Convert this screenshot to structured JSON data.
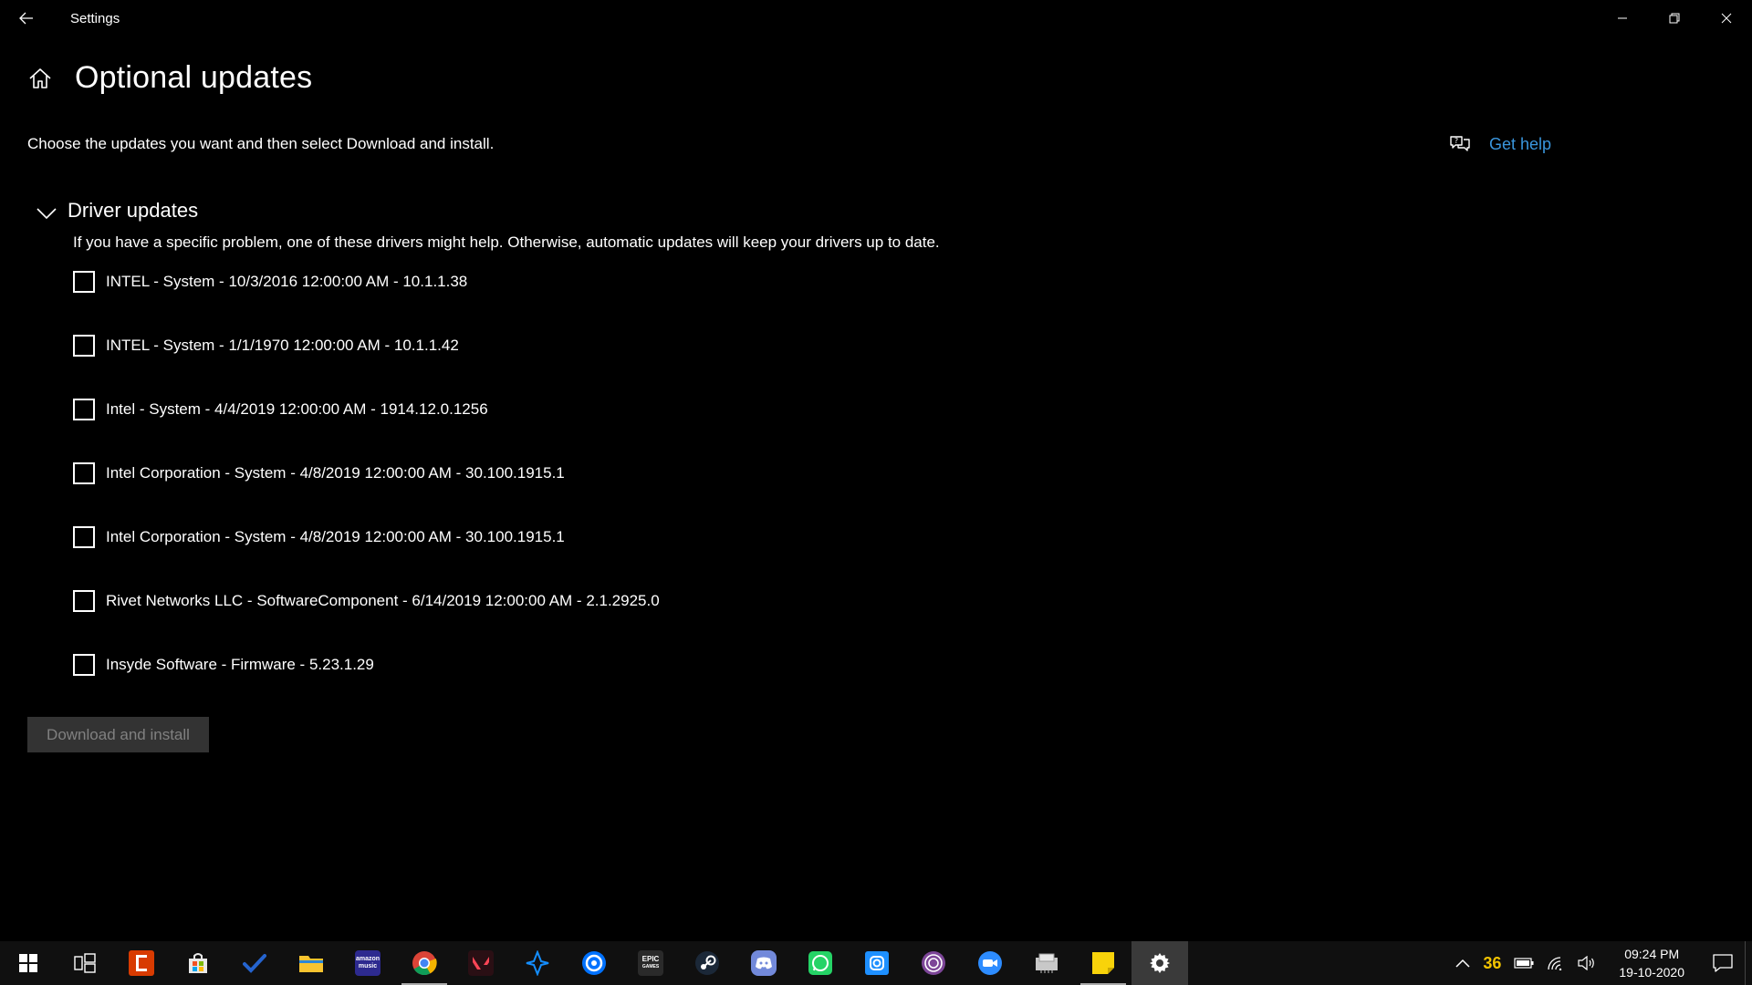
{
  "window": {
    "title": "Settings"
  },
  "page": {
    "title": "Optional updates",
    "description": "Choose the updates you want and then select Download and install.",
    "help_label": "Get help"
  },
  "section": {
    "title": "Driver updates",
    "description": "If you have a specific problem, one of these drivers might help. Otherwise, automatic updates will keep your drivers up to date.",
    "drivers": [
      {
        "label": "INTEL - System - 10/3/2016 12:00:00 AM - 10.1.1.38",
        "checked": false
      },
      {
        "label": "INTEL - System - 1/1/1970 12:00:00 AM - 10.1.1.42",
        "checked": false
      },
      {
        "label": "Intel - System - 4/4/2019 12:00:00 AM - 1914.12.0.1256",
        "checked": false
      },
      {
        "label": "Intel Corporation - System - 4/8/2019 12:00:00 AM - 30.100.1915.1",
        "checked": false
      },
      {
        "label": "Intel Corporation - System - 4/8/2019 12:00:00 AM - 30.100.1915.1",
        "checked": false
      },
      {
        "label": "Rivet Networks LLC - SoftwareComponent - 6/14/2019 12:00:00 AM - 2.1.2925.0",
        "checked": false
      },
      {
        "label": "Insyde Software - Firmware - 5.23.1.29",
        "checked": false
      }
    ]
  },
  "actions": {
    "download_label": "Download and install",
    "download_enabled": false
  },
  "taskbar": {
    "apps": [
      {
        "name": "task-view",
        "icon": "task-view-icon"
      },
      {
        "name": "office",
        "icon": "office-icon",
        "color": "#d83b01"
      },
      {
        "name": "store",
        "icon": "store-icon"
      },
      {
        "name": "todo",
        "icon": "todo-icon",
        "color": "#2564cf"
      },
      {
        "name": "file-explorer",
        "icon": "folder-icon",
        "color": "#f8c42f"
      },
      {
        "name": "amazon-music",
        "icon": "amazon-music-icon",
        "color": "#2d2a8f",
        "text": "amazon music"
      },
      {
        "name": "chrome",
        "icon": "chrome-icon",
        "running": true
      },
      {
        "name": "valorant",
        "icon": "valorant-icon",
        "color": "#fd4556"
      },
      {
        "name": "battle-net",
        "icon": "battlenet-icon",
        "color": "#148eff"
      },
      {
        "name": "uplay",
        "icon": "uplay-icon",
        "color": "#0072ff"
      },
      {
        "name": "epic-games",
        "icon": "epic-games-icon",
        "text": "EPIC GAMES"
      },
      {
        "name": "steam",
        "icon": "steam-icon",
        "color": "#1b2838"
      },
      {
        "name": "discord",
        "icon": "discord-icon",
        "color": "#7289da"
      },
      {
        "name": "whatsapp",
        "icon": "whatsapp-icon",
        "color": "#25d366"
      },
      {
        "name": "instagram",
        "icon": "instagram-icon",
        "color": "#1e90ff"
      },
      {
        "name": "tor-browser",
        "icon": "tor-icon",
        "color": "#7d4698"
      },
      {
        "name": "zoom",
        "icon": "zoom-icon",
        "color": "#2d8cff"
      },
      {
        "name": "cpu-tool",
        "icon": "chip-icon"
      },
      {
        "name": "sticky-notes",
        "icon": "sticky-notes-icon",
        "color": "#f8d30a",
        "running": true
      },
      {
        "name": "settings",
        "icon": "gear-icon",
        "active": true
      }
    ],
    "tray": {
      "badge": "36",
      "time": "09:24 PM",
      "date": "19-10-2020"
    }
  }
}
